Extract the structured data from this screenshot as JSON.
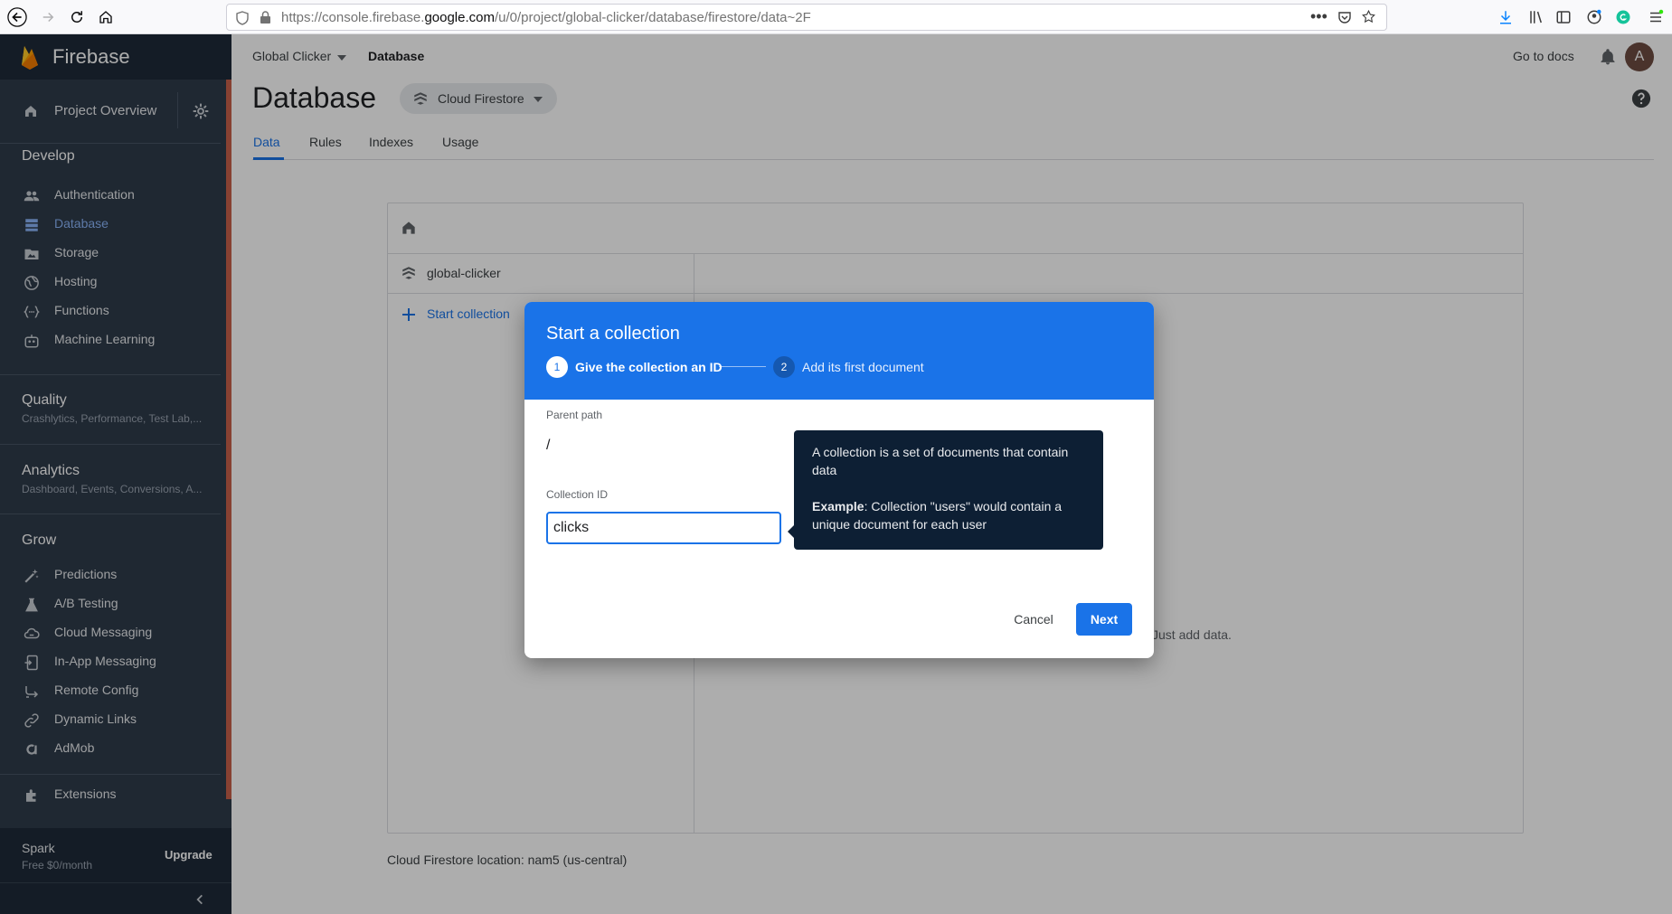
{
  "browser": {
    "url_prefix": "https://console.firebase.",
    "url_domain": "google.com",
    "url_suffix": "/u/0/project/global-clicker/database/firestore/data~2F"
  },
  "sidebar": {
    "brand": "Firebase",
    "project_overview": "Project Overview",
    "develop": {
      "title": "Develop",
      "items": [
        "Authentication",
        "Database",
        "Storage",
        "Hosting",
        "Functions",
        "Machine Learning"
      ]
    },
    "quality": {
      "title": "Quality",
      "subtitle": "Crashlytics, Performance, Test Lab,..."
    },
    "analytics": {
      "title": "Analytics",
      "subtitle": "Dashboard, Events, Conversions, A..."
    },
    "grow": {
      "title": "Grow",
      "items": [
        "Predictions",
        "A/B Testing",
        "Cloud Messaging",
        "In-App Messaging",
        "Remote Config",
        "Dynamic Links",
        "AdMob"
      ]
    },
    "extensions": "Extensions",
    "plan": {
      "name": "Spark",
      "price": "Free $0/month",
      "upgrade": "Upgrade"
    }
  },
  "header": {
    "project": "Global Clicker",
    "section": "Database",
    "docs": "Go to docs",
    "avatar": "A"
  },
  "page": {
    "title": "Database",
    "db_type": "Cloud Firestore",
    "tabs": [
      "Data",
      "Rules",
      "Indexes",
      "Usage"
    ]
  },
  "panel": {
    "root": "global-clicker",
    "start_collection": "Start collection",
    "empty_hint": "Just add data.",
    "location": "Cloud Firestore location: nam5 (us-central)"
  },
  "dialog": {
    "title": "Start a collection",
    "step1": {
      "num": "1",
      "label": "Give the collection an ID"
    },
    "step2": {
      "num": "2",
      "label": "Add its first document"
    },
    "parent_path_label": "Parent path",
    "parent_path_value": "/",
    "collection_id_label": "Collection ID",
    "collection_id_value": "clicks",
    "cancel": "Cancel",
    "next": "Next"
  },
  "tooltip": {
    "line1": "A collection is a set of documents that contain data",
    "example_label": "Example",
    "example_text": ": Collection \"users\" would contain a unique document for each user"
  },
  "colors": {
    "accent": "#1a73e8",
    "sidebar": "#2f3b4a",
    "tooltip": "#0d1f34"
  }
}
